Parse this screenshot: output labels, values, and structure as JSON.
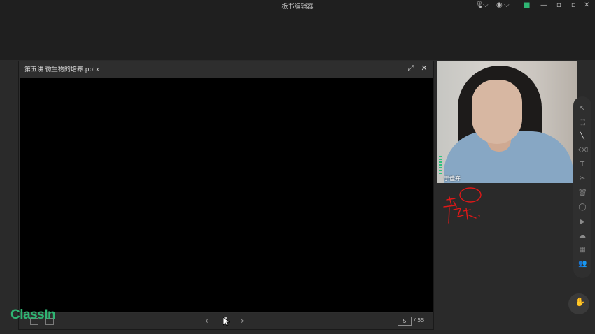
{
  "app": {
    "title": "板书编辑器"
  },
  "window_controls": {
    "minimize": "—",
    "restore": "▫",
    "close": "✕"
  },
  "top_controls": {
    "mic_icon": "🎙",
    "camera_icon": "◉",
    "chevron": "⌵",
    "video_icon": "■",
    "colors": {
      "video_on": "#2fb573"
    }
  },
  "ppt": {
    "title": "第五讲 微生物的培养.pptx",
    "current_page": "5",
    "total_pages": "/ 55",
    "prev": "‹",
    "next": "›",
    "minimize": "−",
    "expand": "⤢",
    "close": "✕"
  },
  "video": {
    "name": "于佳卉"
  },
  "toolbar": {
    "items": [
      "↖",
      "⬚",
      "╲",
      "⌫",
      "T",
      "✂",
      "🗑",
      "◯",
      "▶",
      "☁",
      "▦",
      "👥"
    ]
  },
  "brand": {
    "logo": "ClassIn",
    "color": "#2fb573"
  }
}
